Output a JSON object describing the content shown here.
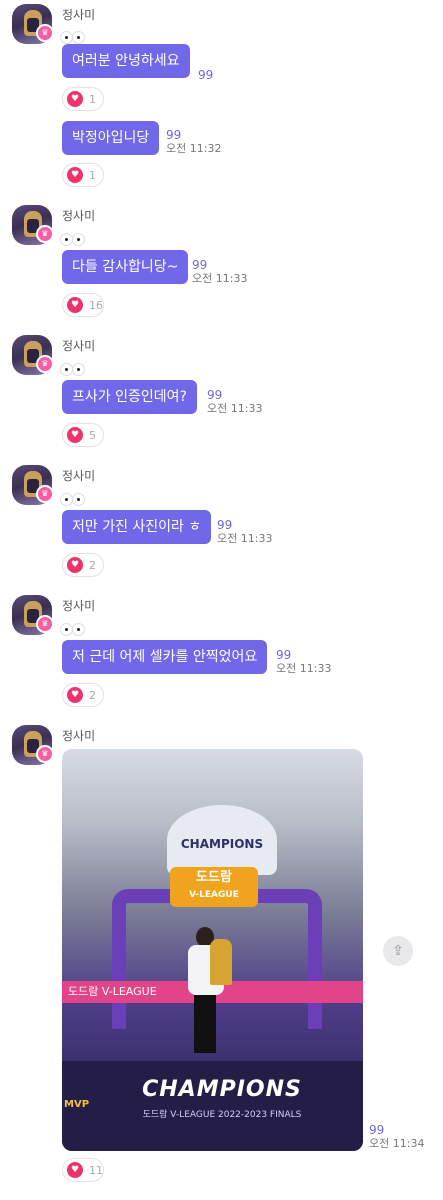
{
  "sender_name": "정사미",
  "messages": [
    {
      "text": "여러분 안녕하세요",
      "unread": "99",
      "time": "",
      "reactions": "1"
    },
    {
      "text": "박정아입니당",
      "unread": "99",
      "time": "오전 11:32",
      "reactions": "1"
    },
    {
      "text": "다들 감사합니당~",
      "unread": "99",
      "time": "오전 11:33",
      "reactions": "16"
    },
    {
      "text": "프사가 인증인데여?",
      "unread": "99",
      "time": "오전 11:33",
      "reactions": "5"
    },
    {
      "text": "저만 가진 사진이라 ㅎ",
      "unread": "99",
      "time": "오전 11:33",
      "reactions": "2"
    },
    {
      "text": "저 근데 어제 셀카를 안찍었어요",
      "unread": "99",
      "time": "오전 11:33",
      "reactions": "2"
    }
  ],
  "photo_message": {
    "unread": "99",
    "time": "오전 11:34",
    "reactions": "11",
    "photo_texts": {
      "banner": "CHAMPIONS",
      "logo_main": "도드람",
      "logo_sub": "V-LEAGUE",
      "band": "도드람 V-LEAGUE",
      "stage_title": "CHAMPIONS",
      "stage_sub": "도드람 V-LEAGUE 2022-2023 FINALS",
      "mvp": "MVP"
    }
  },
  "colors": {
    "bubble": "#7068e8",
    "heart": "#f0326b",
    "crown": "#f45fa3"
  },
  "icons": {
    "heart": "heart-icon",
    "crown": "crown-icon",
    "share": "share-icon"
  }
}
